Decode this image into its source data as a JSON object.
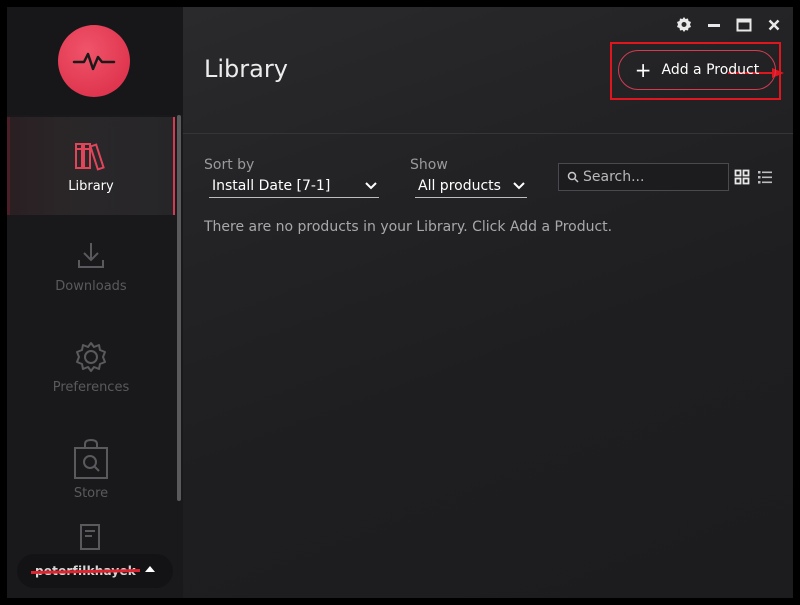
{
  "app": {
    "accent_color": "#d43b50",
    "logo_icon": "heartbeat-pulse-icon"
  },
  "window_controls": {
    "settings_icon": "gear-icon",
    "minimize_icon": "minimize-icon",
    "maximize_icon": "maximize-icon",
    "close_icon": "close-icon"
  },
  "sidebar": {
    "items": [
      {
        "label": "Library",
        "icon": "books-icon",
        "active": true
      },
      {
        "label": "Downloads",
        "icon": "download-icon",
        "active": false
      },
      {
        "label": "Preferences",
        "icon": "gear-icon",
        "active": false
      },
      {
        "label": "Store",
        "icon": "shopping-bag-search-icon",
        "active": false
      }
    ],
    "user": {
      "name": "peterfilkhayek",
      "redacted": true
    }
  },
  "main": {
    "title": "Library",
    "add_button_label": "Add a Product",
    "sort_label": "Sort by",
    "sort_value": "Install Date [7-1]",
    "show_label": "Show",
    "show_value": "All products",
    "search_placeholder": "Search...",
    "empty_message": "There are no products in your Library. Click Add a Product."
  },
  "annotation": {
    "highlight_color": "#e0161f"
  }
}
